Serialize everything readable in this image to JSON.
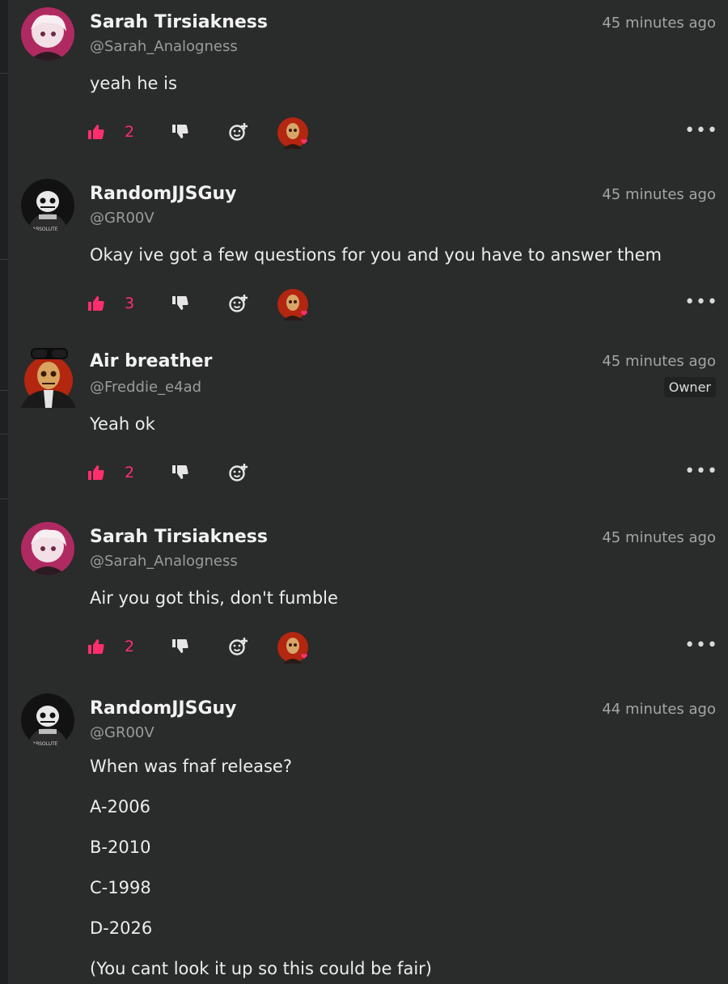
{
  "comments": [
    {
      "name": "Sarah Tirsiakness",
      "handle": "@Sarah_Analogness",
      "time": "45 minutes ago",
      "body": [
        "yeah he is"
      ],
      "likes": "2",
      "has_reaction": true
    },
    {
      "name": "RandomJJSGuy",
      "handle": "@GR00V",
      "time": "45 minutes ago",
      "body": [
        "Okay ive got a few questions for you and you have to answer them"
      ],
      "likes": "3",
      "has_reaction": true
    },
    {
      "name": "Air breather",
      "handle": "@Freddie_e4ad",
      "time": "45 minutes ago",
      "badge": "Owner",
      "body": [
        "Yeah ok"
      ],
      "likes": "2",
      "has_reaction": false
    },
    {
      "name": "Sarah Tirsiakness",
      "handle": "@Sarah_Analogness",
      "time": "45 minutes ago",
      "body": [
        "Air you got this, don't fumble"
      ],
      "likes": "2",
      "has_reaction": true
    },
    {
      "name": "RandomJJSGuy",
      "handle": "@GR00V",
      "time": "44 minutes ago",
      "body": [
        "When was fnaf release?",
        "A-2006",
        "B-2010",
        "C-1998",
        "D-2026",
        "(You cant look it up so this could be fair)"
      ]
    }
  ],
  "avatar_text": "ABSOLUTE",
  "icons": {
    "like": "thumbs-up-icon",
    "dislike": "thumbs-down-icon",
    "react": "add-reaction-icon",
    "more": "more-options-icon"
  },
  "colors": {
    "background": "#2a2b2b",
    "accent": "#ff2f6e",
    "muted": "#9a9b9c"
  }
}
